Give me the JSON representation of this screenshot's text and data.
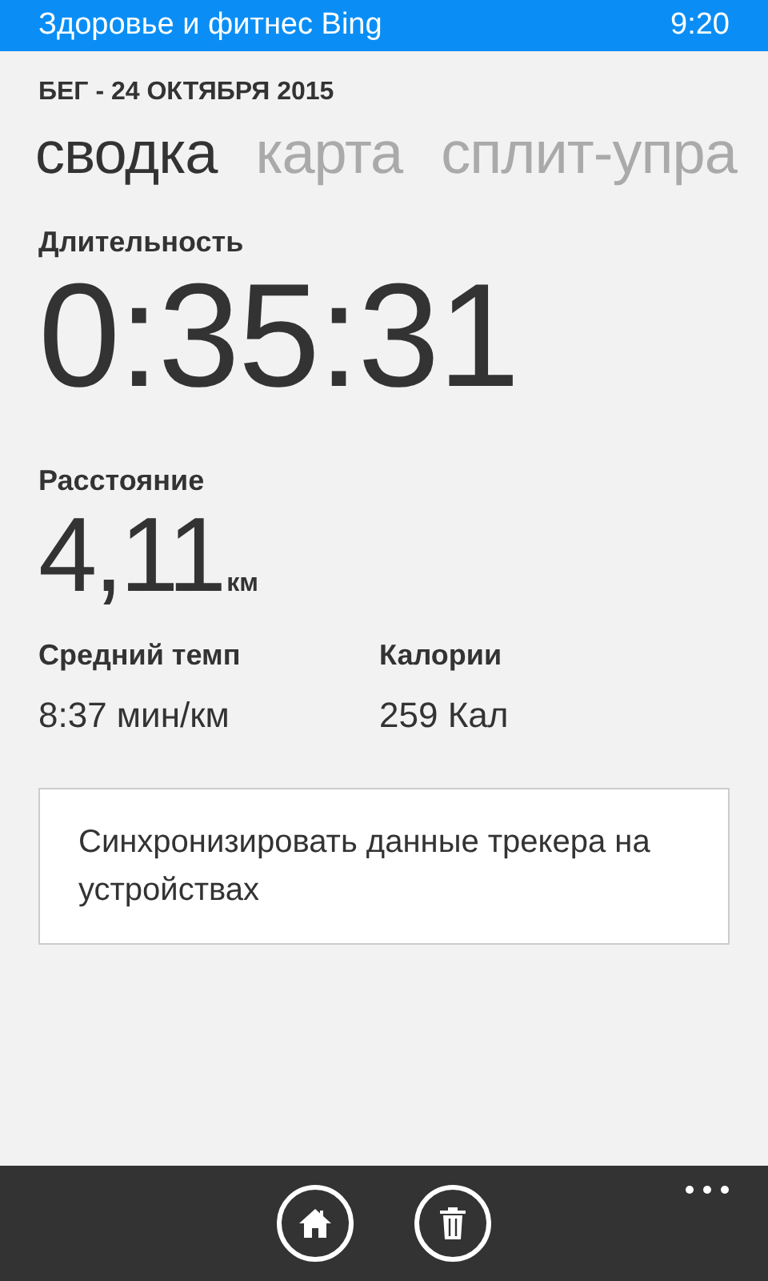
{
  "status_bar": {
    "app_title": "Здоровье и фитнес Bing",
    "time": "9:20"
  },
  "header": "БЕГ - 24 ОКТЯБРЯ 2015",
  "tabs": [
    {
      "label": "сводка",
      "selected": true
    },
    {
      "label": "карта",
      "selected": false
    },
    {
      "label": "сплит-упра",
      "selected": false
    }
  ],
  "duration": {
    "label": "Длительность",
    "value": "0:35:31"
  },
  "distance": {
    "label": "Расстояние",
    "value": "4,11",
    "unit": "км"
  },
  "stats": [
    {
      "label": "Средний темп",
      "value": "8:37 мин/км"
    },
    {
      "label": "Калории",
      "value": "259 Кал"
    }
  ],
  "sync_button": "Синхронизировать данные трекера на устройствах",
  "app_bar": {
    "buttons": [
      {
        "kind": "home"
      },
      {
        "kind": "delete"
      }
    ]
  }
}
